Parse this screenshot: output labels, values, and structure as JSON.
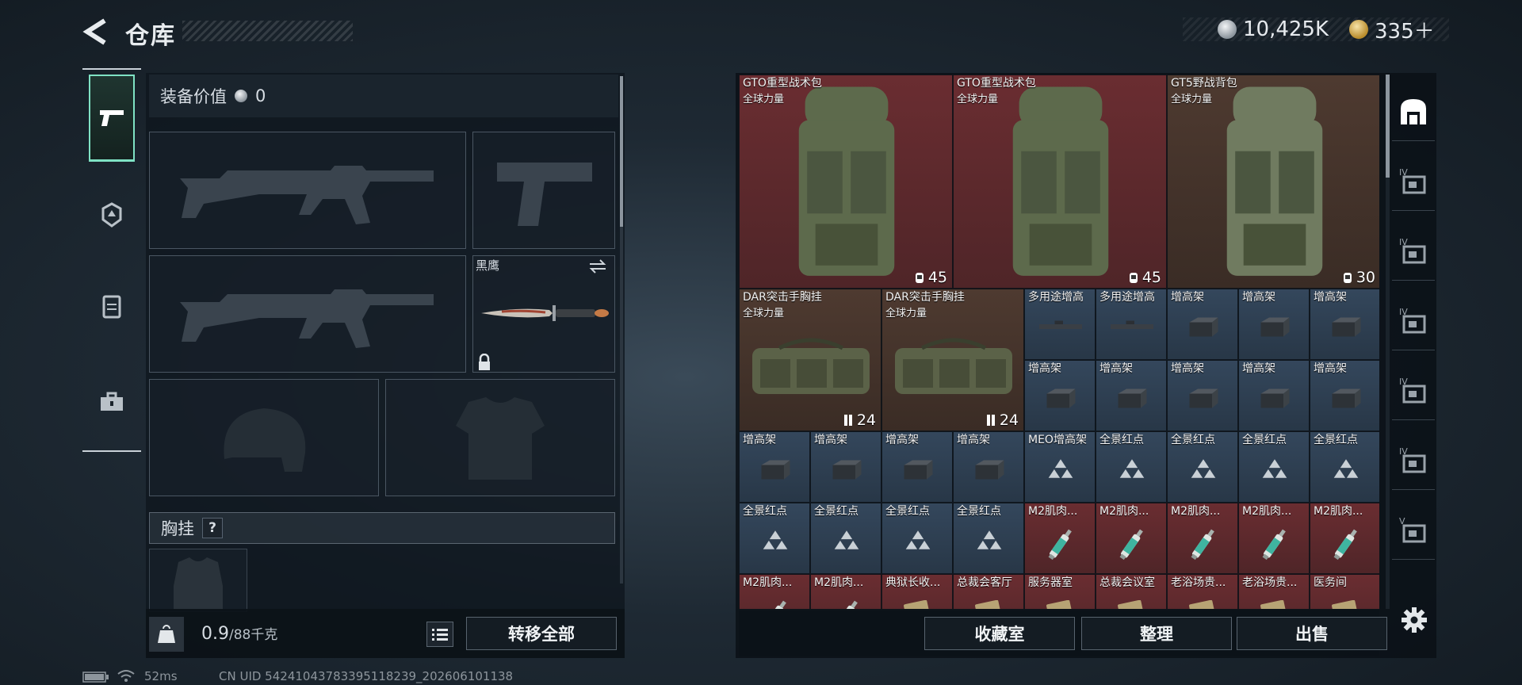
{
  "header": {
    "title": "仓库",
    "currency_silver": "10,425K",
    "currency_gold": "335＋"
  },
  "equipment": {
    "value_label": "装备价值",
    "value": "0",
    "knife_name": "黑鹰",
    "vest_label": "胸挂",
    "help_mark": "?",
    "weight_current": "0.9",
    "weight_max": "/88千克",
    "transfer_all": "转移全部"
  },
  "storage": {
    "items": [
      {
        "name": "GTO重型战术包",
        "sub": "全球力量",
        "count": "45",
        "color": "red",
        "kind": "backpack"
      },
      {
        "name": "GTO重型战术包",
        "sub": "全球力量",
        "count": "45",
        "color": "red",
        "kind": "backpack"
      },
      {
        "name": "GT5野战背包",
        "sub": "全球力量",
        "count": "30",
        "color": "brown",
        "kind": "backpack2"
      },
      {
        "name": "DAR突击手胸挂",
        "sub": "全球力量",
        "count": "24",
        "color": "brown",
        "kind": "rig"
      },
      {
        "name": "DAR突击手胸挂",
        "sub": "全球力量",
        "count": "24",
        "color": "brown",
        "kind": "rig"
      },
      {
        "name": "多用途增高",
        "color": "blue",
        "kind": "rail"
      },
      {
        "name": "多用途增高",
        "color": "blue",
        "kind": "rail"
      },
      {
        "name": "增高架",
        "color": "blue",
        "kind": "riser"
      },
      {
        "name": "增高架",
        "color": "blue",
        "kind": "riser"
      },
      {
        "name": "增高架",
        "color": "blue",
        "kind": "riser"
      },
      {
        "name": "增高架",
        "color": "blue",
        "kind": "riser"
      },
      {
        "name": "增高架",
        "color": "blue",
        "kind": "riser"
      },
      {
        "name": "增高架",
        "color": "blue",
        "kind": "riser"
      },
      {
        "name": "增高架",
        "color": "blue",
        "kind": "riser"
      },
      {
        "name": "增高架",
        "color": "blue",
        "kind": "riser"
      },
      {
        "name": "增高架",
        "color": "blue",
        "kind": "riser"
      },
      {
        "name": "增高架",
        "color": "blue",
        "kind": "riser"
      },
      {
        "name": "增高架",
        "color": "blue",
        "kind": "riser"
      },
      {
        "name": "增高架",
        "color": "blue",
        "kind": "riser"
      },
      {
        "name": "MEO增高架",
        "color": "blue",
        "kind": "tri"
      },
      {
        "name": "全景红点",
        "color": "blue",
        "kind": "tri"
      },
      {
        "name": "全景红点",
        "color": "blue",
        "kind": "tri"
      },
      {
        "name": "全景红点",
        "color": "blue",
        "kind": "tri"
      },
      {
        "name": "全景红点",
        "color": "blue",
        "kind": "tri"
      },
      {
        "name": "全景红点",
        "color": "blue",
        "kind": "tri"
      },
      {
        "name": "全景红点",
        "color": "blue",
        "kind": "tri"
      },
      {
        "name": "全景红点",
        "color": "blue",
        "kind": "tri"
      },
      {
        "name": "全景红点",
        "color": "blue",
        "kind": "tri"
      },
      {
        "name": "M2肌肉...",
        "color": "red",
        "kind": "syringe"
      },
      {
        "name": "M2肌肉...",
        "color": "red",
        "kind": "syringe"
      },
      {
        "name": "M2肌肉...",
        "color": "red",
        "kind": "syringe"
      },
      {
        "name": "M2肌肉...",
        "color": "red",
        "kind": "syringe"
      },
      {
        "name": "M2肌肉...",
        "color": "red",
        "kind": "syringe"
      },
      {
        "name": "M2肌肉...",
        "color": "red",
        "kind": "syringe"
      },
      {
        "name": "M2肌肉...",
        "color": "red",
        "kind": "syringe"
      },
      {
        "name": "典狱长收...",
        "color": "red",
        "kind": "card"
      },
      {
        "name": "总裁会客厅",
        "color": "red",
        "kind": "card"
      },
      {
        "name": "服务器室",
        "color": "red",
        "kind": "card"
      },
      {
        "name": "总裁会议室",
        "color": "red",
        "kind": "card"
      },
      {
        "name": "老浴场贵...",
        "color": "red",
        "kind": "card"
      },
      {
        "name": "老浴场贵...",
        "color": "red",
        "kind": "card"
      },
      {
        "name": "医务间",
        "color": "red",
        "kind": "card"
      }
    ],
    "vault": "收藏室",
    "sort": "整理",
    "sell": "出售"
  },
  "status": {
    "ping": "52ms",
    "uid": "CN UID 54241043783395118239_202606101138"
  },
  "icons": {
    "back": "back-arrow-icon",
    "rail": [
      "pistol-icon",
      "helmet-armor-icon",
      "vest-icon",
      "toolbox-icon"
    ],
    "right_tabs": [
      "storage-all-icon",
      "tab-iv-icon",
      "tab-iv-camera-icon",
      "tab-iv-tools-icon",
      "tab-iv-warning-icon",
      "tab-iv-medkit-icon",
      "tab-v-icon"
    ],
    "settings": "gear-icon"
  }
}
